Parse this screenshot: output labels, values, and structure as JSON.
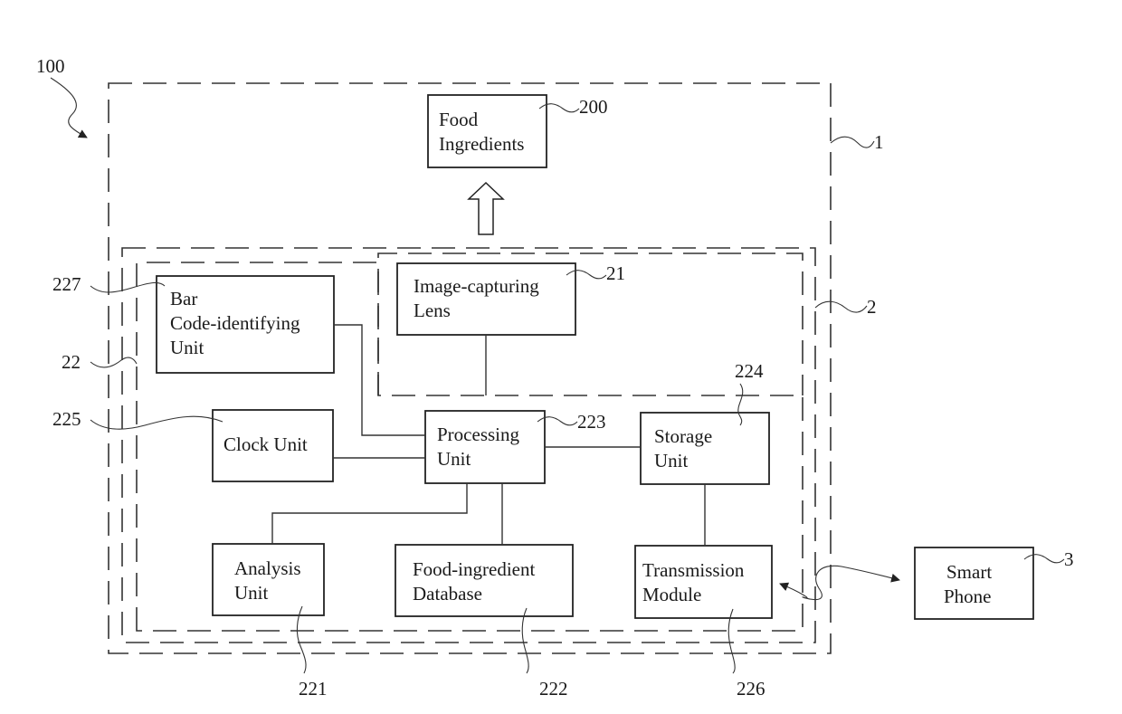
{
  "figure": {
    "system_ref": "100",
    "containers": {
      "outer": {
        "ref": "1"
      },
      "device": {
        "ref": "2"
      },
      "processing_module": {
        "ref": "22"
      }
    },
    "blocks": {
      "food_ingredients": {
        "ref": "200",
        "lines": [
          "Food",
          "Ingredients"
        ]
      },
      "image_capturing_lens": {
        "ref": "21",
        "lines": [
          "Image-capturing",
          "Lens"
        ]
      },
      "bar_code_unit": {
        "ref": "227",
        "lines": [
          "Bar",
          "Code-identifying",
          "Unit"
        ]
      },
      "clock_unit": {
        "ref": "225",
        "lines": [
          "Clock Unit"
        ]
      },
      "processing_unit": {
        "ref": "223",
        "lines": [
          "Processing",
          "Unit"
        ]
      },
      "storage_unit": {
        "ref": "224",
        "lines": [
          "Storage",
          "Unit"
        ]
      },
      "analysis_unit": {
        "ref": "221",
        "lines": [
          "Analysis",
          "Unit"
        ]
      },
      "food_ingredient_database": {
        "ref": "222",
        "lines": [
          "Food-ingredient",
          "Database"
        ]
      },
      "transmission_module": {
        "ref": "226",
        "lines": [
          "Transmission",
          "Module"
        ]
      },
      "smart_phone": {
        "ref": "3",
        "lines": [
          "Smart",
          "Phone"
        ]
      }
    }
  }
}
